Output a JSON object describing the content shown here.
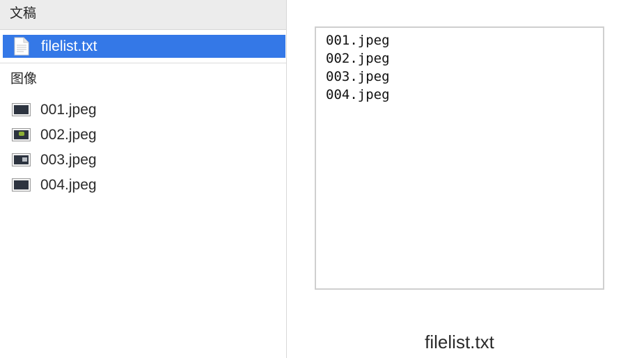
{
  "sidebar": {
    "documents_header": "文稿",
    "selected_file": {
      "name": "filelist.txt",
      "icon": "text-document-icon"
    },
    "images_header": "图像",
    "images": [
      {
        "name": "001.jpeg",
        "icon": "image-thumbnail-icon"
      },
      {
        "name": "002.jpeg",
        "icon": "image-thumbnail-icon"
      },
      {
        "name": "003.jpeg",
        "icon": "image-thumbnail-icon"
      },
      {
        "name": "004.jpeg",
        "icon": "image-thumbnail-icon"
      }
    ]
  },
  "preview": {
    "lines": [
      "001.jpeg",
      "002.jpeg",
      "003.jpeg",
      "004.jpeg"
    ],
    "caption": "filelist.txt"
  },
  "colors": {
    "selection": "#3478e7",
    "header_background": "#ececec"
  }
}
